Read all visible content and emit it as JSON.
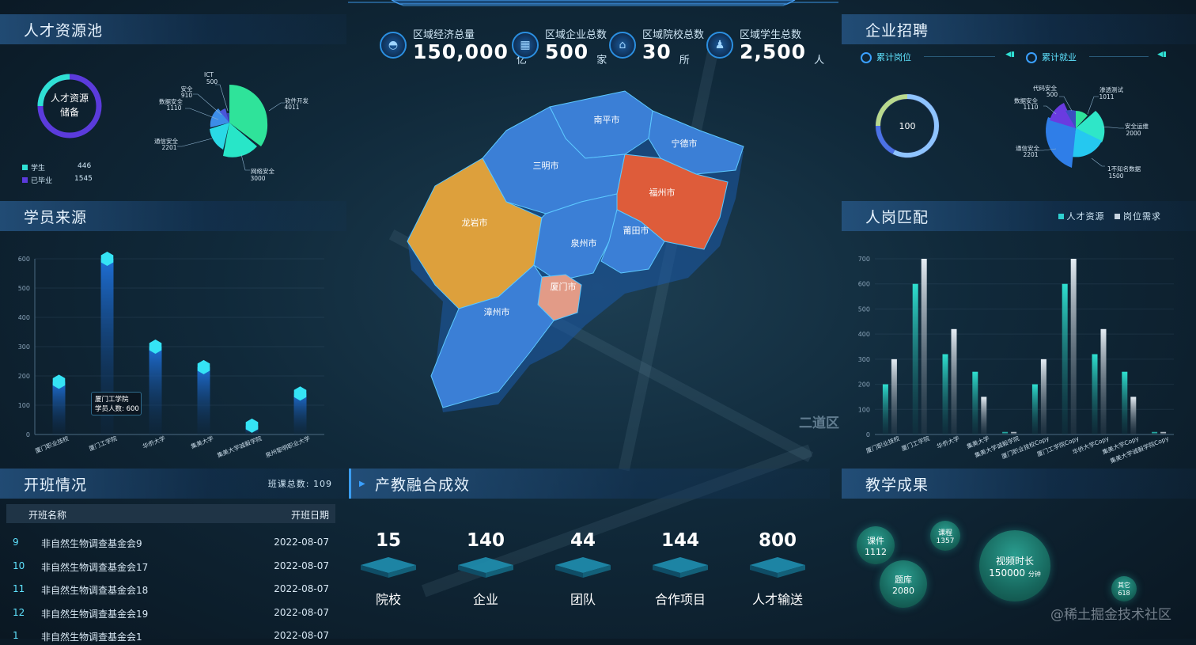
{
  "header": {
    "stats": [
      {
        "icon": "database-icon",
        "label": "区域经济总量",
        "value": "150,000",
        "unit": "亿"
      },
      {
        "icon": "building-icon",
        "label": "区域企业总数",
        "value": "500",
        "unit": "家"
      },
      {
        "icon": "school-icon",
        "label": "区域院校总数",
        "value": "30",
        "unit": "所"
      },
      {
        "icon": "users-icon",
        "label": "区域学生总数",
        "value": "2,500",
        "unit": "人"
      }
    ]
  },
  "talent_pool": {
    "title": "人才资源池",
    "ring_label_1": "人才资源",
    "ring_label_2": "储备",
    "legend": [
      {
        "name": "学生",
        "value": "446",
        "color": "#2fe0d4"
      },
      {
        "name": "已毕业",
        "value": "1545",
        "color": "#5b3bdc"
      }
    ],
    "rose": [
      {
        "name": "ICT",
        "value": "500"
      },
      {
        "name": "安全",
        "value": "910"
      },
      {
        "name": "数据安全",
        "value": "1110"
      },
      {
        "name": "通信安全",
        "value": "2201"
      },
      {
        "name": "网络安全",
        "value": "3000"
      },
      {
        "name": "软件开发",
        "value": "4011"
      }
    ]
  },
  "student_source": {
    "title": "学员来源",
    "yticks": [
      "0",
      "100",
      "200",
      "300",
      "400",
      "500",
      "600"
    ],
    "tooltip_title": "厦门工学院",
    "tooltip_text": "学员人数: 600"
  },
  "classes": {
    "title": "开班情况",
    "total_label": "班课总数:  109",
    "col_name": "开班名称",
    "col_date": "开班日期",
    "rows": [
      {
        "idx": "9",
        "name": "非自然生物调查基金会9",
        "date": "2022-08-07"
      },
      {
        "idx": "10",
        "name": "非自然生物调查基金会17",
        "date": "2022-08-07"
      },
      {
        "idx": "11",
        "name": "非自然生物调查基金会18",
        "date": "2022-08-07"
      },
      {
        "idx": "12",
        "name": "非自然生物调查基金会19",
        "date": "2022-08-07"
      },
      {
        "idx": "1",
        "name": "非自然生物调查基金会1",
        "date": "2022-08-07"
      }
    ]
  },
  "map": {
    "cities": [
      "南平市",
      "宁德市",
      "三明市",
      "福州市",
      "龙岩市",
      "泉州市",
      "莆田市",
      "厦门市",
      "漳州市"
    ],
    "district_label": "二道区"
  },
  "integration": {
    "title": "产教融合成效",
    "kpis": [
      {
        "value": "15",
        "label": "院校"
      },
      {
        "value": "140",
        "label": "企业"
      },
      {
        "value": "44",
        "label": "团队"
      },
      {
        "value": "144",
        "label": "合作项目"
      },
      {
        "value": "800",
        "label": "人才输送"
      }
    ]
  },
  "recruitment": {
    "title": "企业招聘",
    "tab1": "累计岗位",
    "tab2": "累计就业",
    "ring_value": "100",
    "rose": [
      {
        "name": "代码安全",
        "value": "500"
      },
      {
        "name": "渗透测试",
        "value": "1011"
      },
      {
        "name": "数据安全",
        "value": "1110"
      },
      {
        "name": "安全运维",
        "value": "2000"
      },
      {
        "name": "通信安全",
        "value": "2201"
      },
      {
        "name": "1不知名数据",
        "value": "1500"
      }
    ]
  },
  "matching": {
    "title": "人岗匹配",
    "legend1": "人才资源",
    "legend2": "岗位需求",
    "yticks": [
      "0",
      "100",
      "200",
      "300",
      "400",
      "500",
      "600",
      "700"
    ]
  },
  "teaching": {
    "title": "教学成果",
    "bubbles": [
      {
        "name": "课件",
        "value": "1112"
      },
      {
        "name": "课程",
        "value": "1357"
      },
      {
        "name": "题库",
        "value": "2080"
      },
      {
        "name": "视频时长",
        "value": "150000",
        "unit": "分钟"
      },
      {
        "name": "其它",
        "value": "618"
      }
    ]
  },
  "watermark": "@稀土掘金技术社区",
  "chart_data": [
    {
      "type": "bar",
      "title": "学员来源",
      "categories": [
        "厦门职业技校",
        "厦门工学院",
        "华侨大学",
        "集美大学",
        "集美大学诚毅学院",
        "泉州黎明职业大学"
      ],
      "values": [
        180,
        600,
        300,
        230,
        30,
        140
      ],
      "ylim": [
        0,
        600
      ]
    },
    {
      "type": "bar",
      "title": "人岗匹配",
      "categories": [
        "厦门职业技校",
        "厦门工学院",
        "华侨大学",
        "集美大学",
        "集美大学诚毅学院",
        "厦门职业技校Copy",
        "厦门工学院Copy",
        "华侨大学Copy",
        "集美大学Copy",
        "集美大学诚毅学院Copy"
      ],
      "series": [
        {
          "name": "人才资源",
          "values": [
            200,
            600,
            320,
            250,
            10,
            200,
            600,
            320,
            250,
            10
          ]
        },
        {
          "name": "岗位需求",
          "values": [
            300,
            700,
            420,
            150,
            10,
            300,
            700,
            420,
            150,
            10
          ]
        }
      ],
      "ylim": [
        0,
        700
      ]
    }
  ]
}
